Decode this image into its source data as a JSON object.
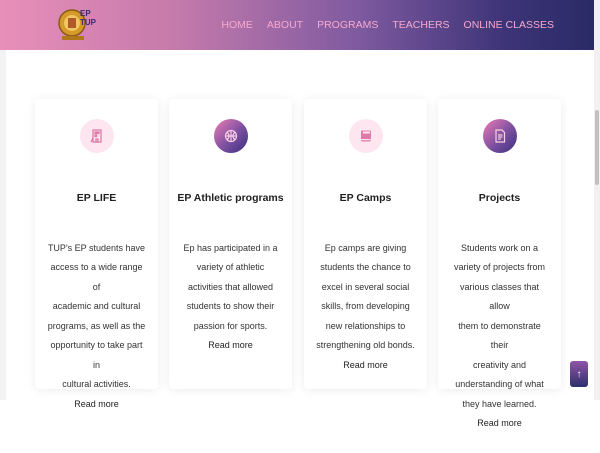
{
  "header": {
    "logo_text": "EP\nTUP",
    "nav": [
      "HOME",
      "ABOUT",
      "PROGRAMS",
      "TEACHERS",
      "ONLINE CLASSES"
    ]
  },
  "cards": [
    {
      "icon": "building-icon",
      "title": "EP LIFE",
      "text": "TUP's EP students have\naccess to a wide range of\nacademic and cultural\nprograms, as well as the\nopportunity to take part in\ncultural activities.",
      "read_more": "Read more"
    },
    {
      "icon": "basketball-icon",
      "title": "EP Athletic programs",
      "text": "Ep has participated in a\nvariety of athletic\nactivities that allowed\nstudents to show their\npassion for sports.",
      "read_more": "Read more"
    },
    {
      "icon": "book-icon",
      "title": "EP Camps",
      "text": "Ep camps are giving\nstudents the chance to\nexcel in several social\nskills, from developing\nnew relationships to\nstrengthening old bonds.",
      "read_more": "Read more"
    },
    {
      "icon": "document-icon",
      "title": "Projects",
      "text": "Students work on a\nvariety of projects from\nvarious classes that allow\nthem to demonstrate their\ncreativity and\nunderstanding of what\nthey have learned.",
      "read_more": "Read more"
    }
  ],
  "back_to_top_icon": "arrow-up-icon",
  "colors": {
    "accent_pink": "#f7a9cf",
    "dark_purple": "#2a2b66"
  }
}
